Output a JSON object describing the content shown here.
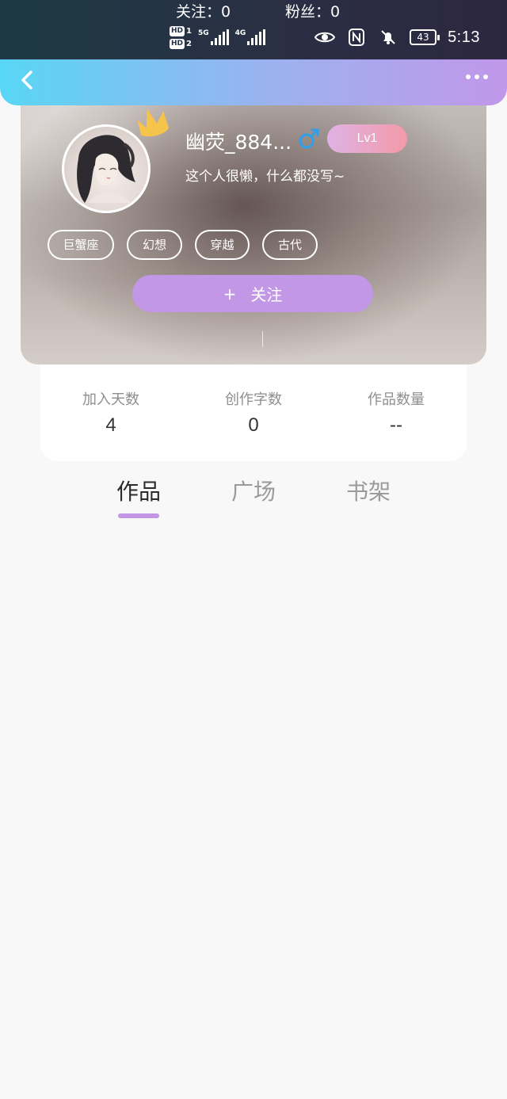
{
  "status_bar": {
    "sim1": "HD",
    "sim1_slot": "1",
    "sim2": "HD",
    "sim2_slot": "2",
    "network1": "5G",
    "network2": "4G",
    "battery": "43",
    "time": "5:13"
  },
  "nav": {
    "back_icon": "chevron-left-icon",
    "more_icon": "more-dots-icon"
  },
  "profile": {
    "username": "幽荧_884...",
    "gender_icon": "male-icon",
    "level": "Lv1",
    "bio": "这个人很懒，什么都没写~",
    "tags": [
      "巨蟹座",
      "幻想",
      "穿越",
      "古代"
    ],
    "follow_label": "关注",
    "following": "关注：0",
    "followers": "粉丝：0"
  },
  "stats": [
    {
      "label": "加入天数",
      "value": "4"
    },
    {
      "label": "创作字数",
      "value": "0"
    },
    {
      "label": "作品数量",
      "value": "--"
    }
  ],
  "tabs": [
    {
      "label": "作品",
      "active": true
    },
    {
      "label": "广场",
      "active": false
    },
    {
      "label": "书架",
      "active": false
    }
  ],
  "colors": {
    "accent_purple": "#c197e6",
    "nav_gradient_start": "#58d6f5",
    "nav_gradient_end": "#c197ea",
    "gender_blue": "#2f9fe8",
    "crown_yellow": "#f6c44a"
  }
}
